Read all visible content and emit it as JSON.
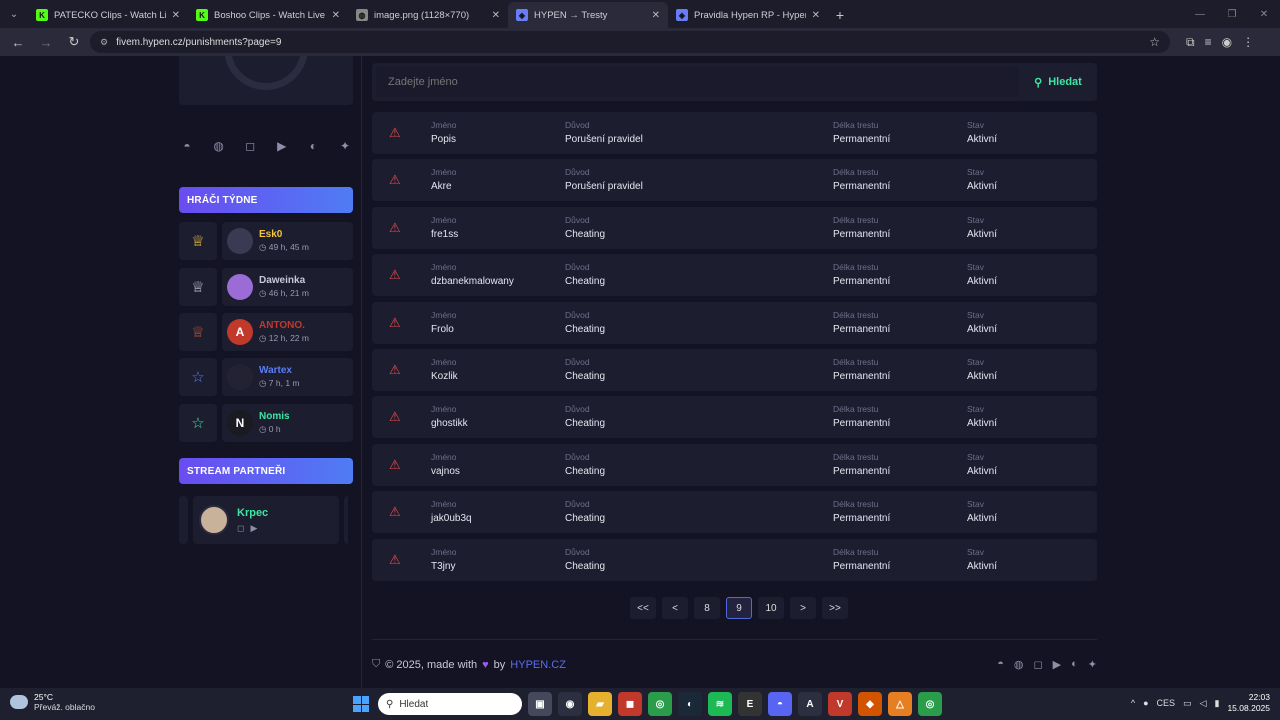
{
  "browser": {
    "tabs": [
      {
        "title": "PATECKO Clips - Watch Live on",
        "icon": "K",
        "color": "#53fc18",
        "active": false
      },
      {
        "title": "Boshoo Clips - Watch Live on K",
        "icon": "K",
        "color": "#53fc18",
        "active": false
      },
      {
        "title": "image.png (1128×770)",
        "icon": "◍",
        "color": "#888888",
        "active": false
      },
      {
        "title": "HYPEN → Tresty",
        "icon": "◈",
        "color": "#6a7cf5",
        "active": true
      },
      {
        "title": "Pravidla Hypen RP - Hypen",
        "icon": "◈",
        "color": "#6a7cf5",
        "active": false
      }
    ],
    "url": "fivem.hypen.cz/punishments?page=9"
  },
  "sidebar": {
    "top_week_title": "HRÁČI TÝDNE",
    "players": [
      {
        "name": "Esk0",
        "time": "49 h, 45 m",
        "color": "#f5c542",
        "rank_color": "#f5c542",
        "rank_icon": "trophy-icon",
        "av_bg": "#3a3a55",
        "av_text": ""
      },
      {
        "name": "Daweinka",
        "time": "46 h, 21 m",
        "color": "#c8c8d8",
        "rank_color": "#c8c8d8",
        "rank_icon": "trophy-icon",
        "av_bg": "#9b6bd6",
        "av_text": ""
      },
      {
        "name": "ANTONO.",
        "time": "12 h, 22 m",
        "color": "#c0392b",
        "rank_color": "#c0562b",
        "rank_icon": "trophy-icon",
        "av_bg": "#c0392b",
        "av_text": "A"
      },
      {
        "name": "Wartex",
        "time": "7 h, 1 m",
        "color": "#5b7cf5",
        "rank_color": "#5b7cf5",
        "rank_icon": "star-icon",
        "av_bg": "#222233",
        "av_text": ""
      },
      {
        "name": "Nomis",
        "time": "0 h",
        "color": "#3ee6a0",
        "rank_color": "#3ee6a0",
        "rank_icon": "star-icon",
        "av_bg": "#1a1a22",
        "av_text": "N"
      }
    ],
    "partners_title": "STREAM PARTNEŘI",
    "partner": {
      "name": "Krpec"
    }
  },
  "search": {
    "placeholder": "Zadejte jméno",
    "button": "Hledat"
  },
  "labels": {
    "name": "Jméno",
    "reason": "Důvod",
    "length": "Délka trestu",
    "state": "Stav"
  },
  "punishments": [
    {
      "name": "Popis",
      "reason": "Porušení pravidel",
      "length": "Permanentní",
      "state": "Aktivní"
    },
    {
      "name": "Akre",
      "reason": "Porušení pravidel",
      "length": "Permanentní",
      "state": "Aktivní"
    },
    {
      "name": "fre1ss",
      "reason": "Cheating",
      "length": "Permanentní",
      "state": "Aktivní"
    },
    {
      "name": "dzbanekmalowany",
      "reason": "Cheating",
      "length": "Permanentní",
      "state": "Aktivní"
    },
    {
      "name": "Frolo",
      "reason": "Cheating",
      "length": "Permanentní",
      "state": "Aktivní"
    },
    {
      "name": "Kozlik",
      "reason": "Cheating",
      "length": "Permanentní",
      "state": "Aktivní"
    },
    {
      "name": "ghostikk",
      "reason": "Cheating",
      "length": "Permanentní",
      "state": "Aktivní"
    },
    {
      "name": "vajnos",
      "reason": "Cheating",
      "length": "Permanentní",
      "state": "Aktivní"
    },
    {
      "name": "jak0ub3q",
      "reason": "Cheating",
      "length": "Permanentní",
      "state": "Aktivní"
    },
    {
      "name": "T3jny",
      "reason": "Cheating",
      "length": "Permanentní",
      "state": "Aktivní"
    }
  ],
  "pagination": [
    {
      "label": "<<",
      "current": false
    },
    {
      "label": "<",
      "current": false
    },
    {
      "label": "8",
      "current": false
    },
    {
      "label": "9",
      "current": true
    },
    {
      "label": "10",
      "current": false
    },
    {
      "label": ">",
      "current": false
    },
    {
      "label": ">>",
      "current": false
    }
  ],
  "footer": {
    "copy": "© 2025, made with",
    "by": "by",
    "brand": "HYPEN.CZ"
  },
  "taskbar": {
    "temp": "25°C",
    "weather": "Převáž. oblačno",
    "search": "Hledat",
    "lang": "CES",
    "time": "22:03",
    "date": "15.08.2025"
  }
}
